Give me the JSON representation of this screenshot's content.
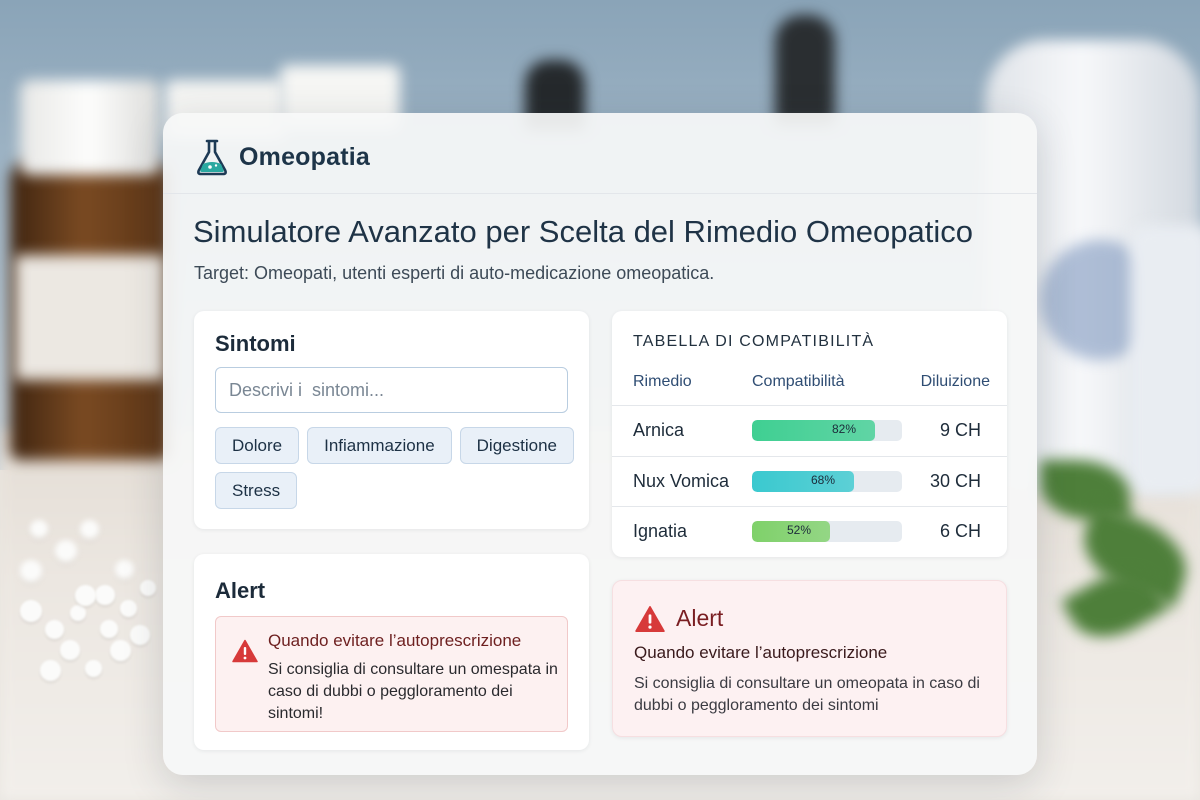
{
  "app": {
    "brand_name": "Omeopatia",
    "title": "Simulatore Avanzato per Scelta del Rimedio Omeopatico",
    "subtitle": "Target: Omeopati, utenti esperti di auto-medicazione omeopatica."
  },
  "symptoms": {
    "title": "Sintomi",
    "search_placeholder": "Descrivi i  sintomi...",
    "chips": [
      "Dolore",
      "Infiammazione",
      "Digestione",
      "Stress"
    ]
  },
  "compatibility": {
    "title": "TABELLA DI COMPATIBILITÀ",
    "columns": [
      "Rimedio",
      "Compatibilità",
      "Diluizione"
    ],
    "rows": [
      {
        "remedy": "Arnica",
        "compat_label": "82%",
        "compat_value": 82,
        "dilution": "9 CH",
        "color": "#3fcf92"
      },
      {
        "remedy": "Nux Vomica",
        "compat_label": "68%",
        "compat_value": 68,
        "dilution": "30 CH",
        "color": "#3ac9cf"
      },
      {
        "remedy": "Ignatia",
        "compat_label": "52%",
        "compat_value": 52,
        "dilution": "6 CH",
        "color": "#7fd16a"
      }
    ]
  },
  "alert_left": {
    "title": "Alert",
    "heading": "Quando evitare l’autoprescrizione",
    "text": "Si consiglia di consultare un omespata in caso di dubbi o peggloramento dei sintomi!"
  },
  "alert_right": {
    "title": "Alert",
    "heading": "Quando evitare l’autoprescrizione",
    "text": "Si consiglia di consultare un omeopata in caso di dubbi o peggloramento dei sintomi"
  },
  "colors": {
    "accent": "#1d3448",
    "alert_red": "#d73a3a",
    "chip_bg": "#e9f0f8"
  },
  "icons": {
    "brand": "flask-icon",
    "alert": "warning-triangle-icon"
  }
}
